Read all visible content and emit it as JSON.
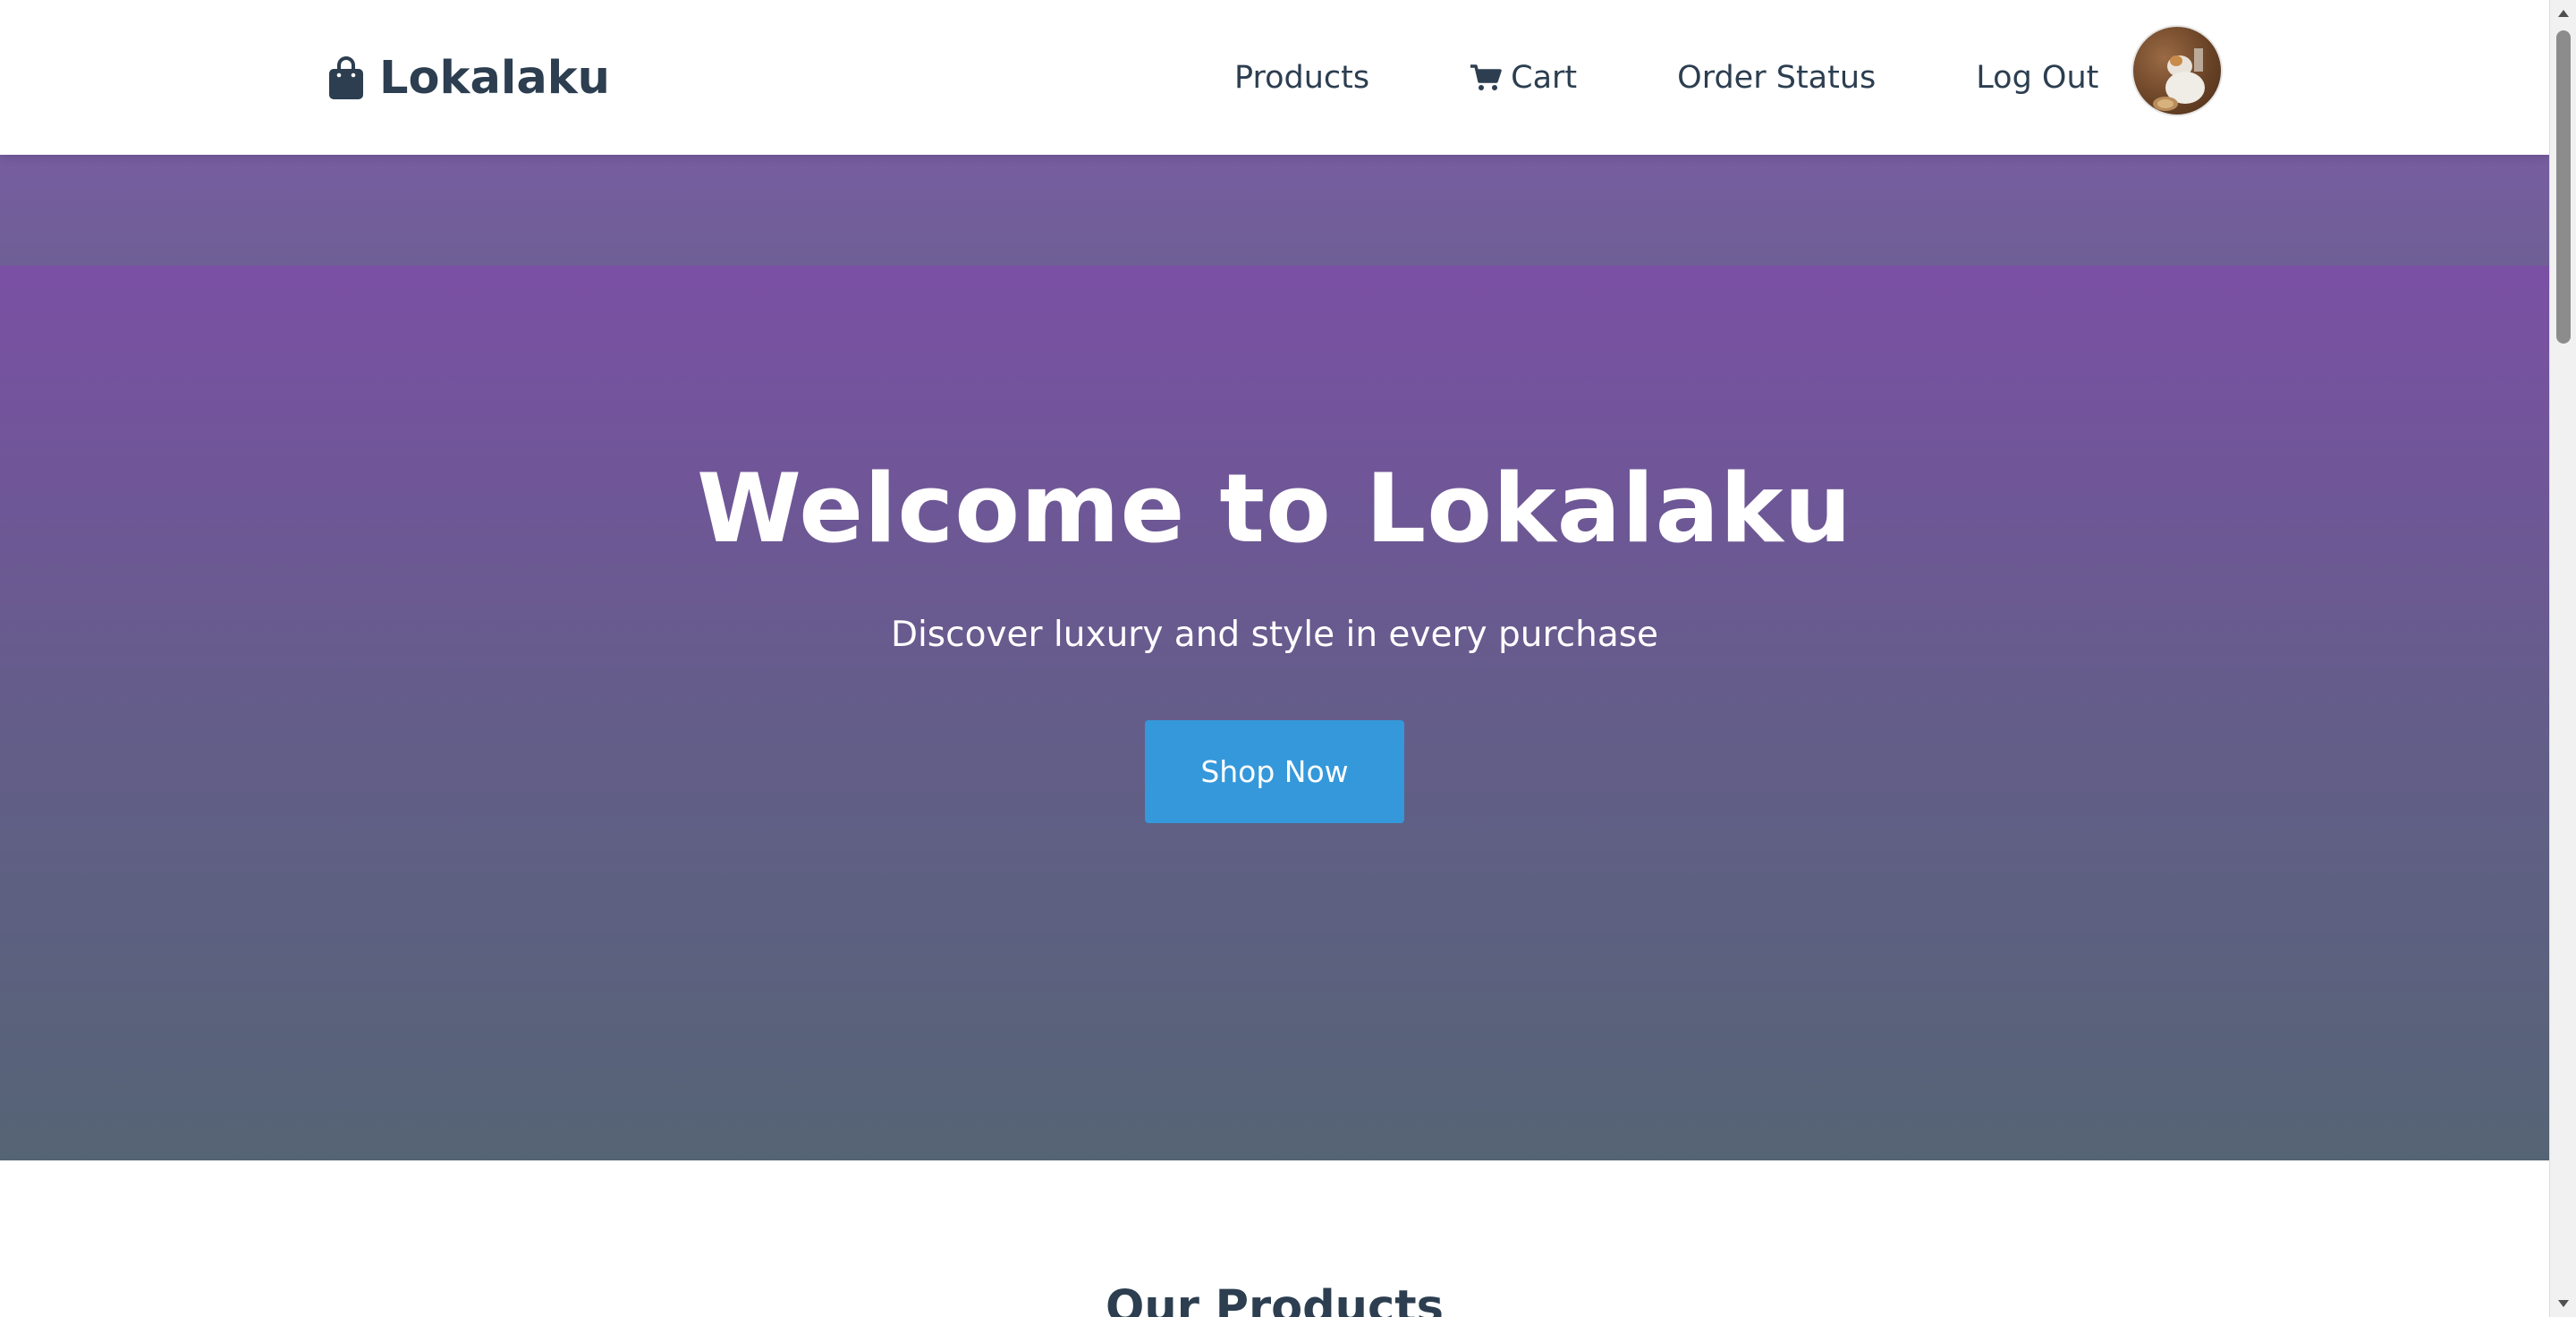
{
  "navbar": {
    "brand": "Lokalaku",
    "links": {
      "products": "Products",
      "cart": "Cart",
      "order_status": "Order Status",
      "logout": "Log Out"
    },
    "icons": {
      "brand": "shopping-bag-icon",
      "cart": "cart-icon"
    }
  },
  "hero": {
    "title": "Welcome to Lokalaku",
    "subtitle": "Discover luxury and style in every purchase",
    "cta": "Shop Now"
  },
  "products_section": {
    "title": "Our Products"
  },
  "colors": {
    "text_dark": "#2c3e50",
    "accent_button": "#3498db",
    "hero_gradient_top": "#7a50a4",
    "hero_gradient_bottom": "#556475"
  }
}
